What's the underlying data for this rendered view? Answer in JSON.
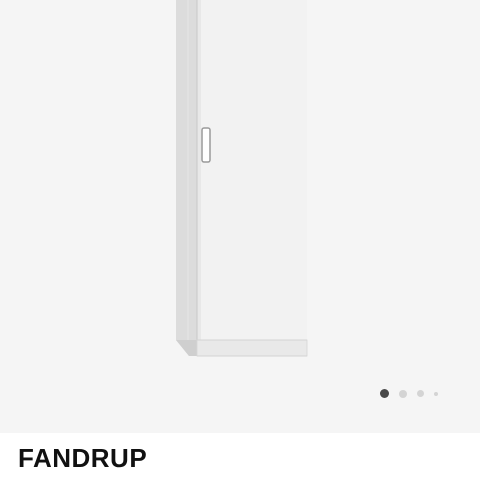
{
  "product": {
    "name": "FANDRUP"
  },
  "gallery": {
    "image_icon": "white-wardrobe-cabinet",
    "dots": [
      {
        "state": "active"
      },
      {
        "state": "inactive"
      },
      {
        "state": "inactive"
      },
      {
        "state": "inactive"
      }
    ],
    "active_index": 1,
    "colors": {
      "background": "#f5f5f5",
      "active_dot": "#484848",
      "inactive_dot": "#d4d4d4"
    }
  }
}
